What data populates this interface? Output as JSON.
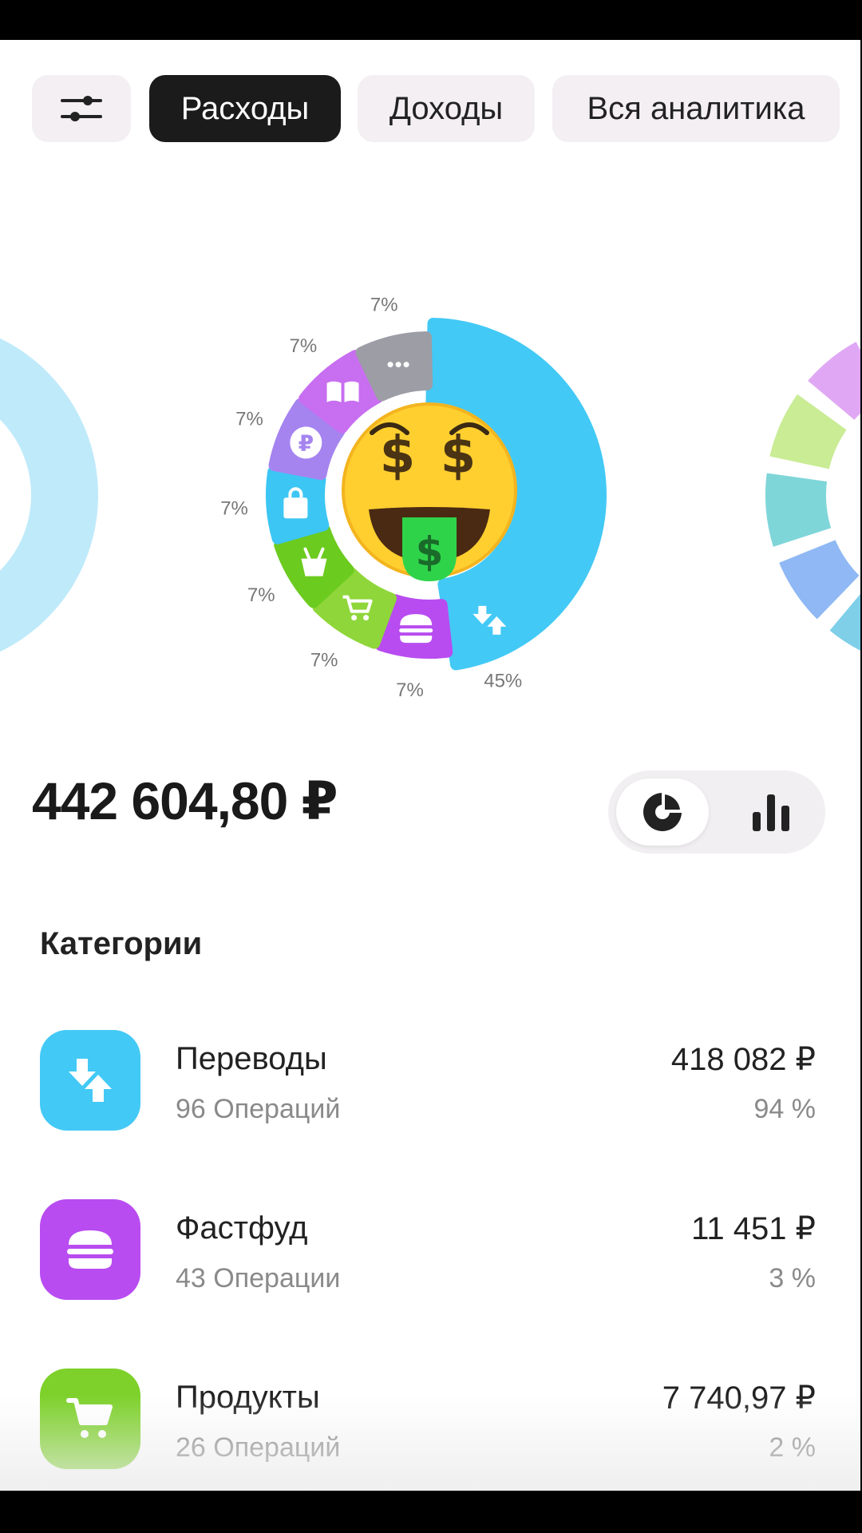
{
  "tabs": {
    "filter_icon": "sliders-icon",
    "items": [
      {
        "label": "Расходы",
        "active": true
      },
      {
        "label": "Доходы",
        "active": false
      },
      {
        "label": "Вся аналитика",
        "active": false
      }
    ]
  },
  "chart_data": {
    "type": "pie",
    "categories": [
      "Переводы",
      "Фастфуд",
      "Продукты",
      "Супермаркеты",
      "Покупки",
      "Платежи",
      "Книги",
      "Другое"
    ],
    "values": [
      45,
      7,
      7,
      7,
      7,
      7,
      7,
      7
    ],
    "labels": [
      "45%",
      "7%",
      "7%",
      "7%",
      "7%",
      "7%",
      "7%",
      "7%"
    ],
    "colors": [
      "#43c9f5",
      "#b84cf0",
      "#8fd63a",
      "#6ccb1f",
      "#3cc6f3",
      "#a584f0",
      "#c86ef0",
      "#9d9da6"
    ],
    "icons": [
      "transfer-icon",
      "burger-icon",
      "cart-icon",
      "bag-basket-icon",
      "shopping-bag-icon",
      "ruble-icon",
      "book-icon",
      "more-icon"
    ],
    "center_icon": "money-face-emoji"
  },
  "total": "442 604,80 ₽",
  "view_toggle": {
    "pie_icon": "pie-chart-icon",
    "bar_icon": "bar-chart-icon"
  },
  "categories_title": "Категории",
  "categories": [
    {
      "name": "Переводы",
      "ops": "96 Операций",
      "amount": "418 082 ₽",
      "pct": "94 %",
      "color": "#43c9f5",
      "icon": "transfer-icon"
    },
    {
      "name": "Фастфуд",
      "ops": "43 Операции",
      "amount": "11 451 ₽",
      "pct": "3 %",
      "color": "#b84cf0",
      "icon": "burger-icon"
    },
    {
      "name": "Продукты",
      "ops": "26 Операций",
      "amount": "7 740,97 ₽",
      "pct": "2 %",
      "color": "#7dd12a",
      "icon": "cart-icon"
    }
  ]
}
